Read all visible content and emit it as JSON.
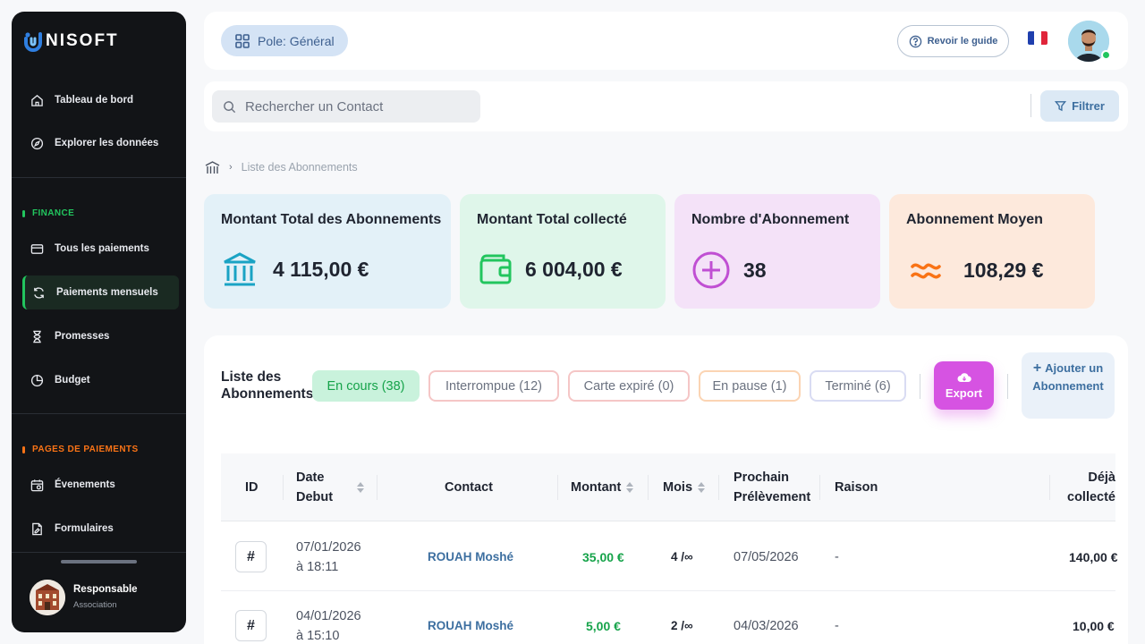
{
  "app": {
    "logo_text": "NISOFT"
  },
  "sidebar": {
    "top_items": [
      {
        "label": "Tableau de bord",
        "icon": "home-icon"
      },
      {
        "label": "Explorer les données",
        "icon": "compass-icon"
      }
    ],
    "finance_label": "FINANCE",
    "finance_items": [
      {
        "label": "Tous les paiements",
        "icon": "card-icon"
      },
      {
        "label": "Paiements mensuels",
        "icon": "refresh-icon",
        "active": true
      },
      {
        "label": "Promesses",
        "icon": "hourglass-icon"
      },
      {
        "label": "Budget",
        "icon": "pie-icon"
      }
    ],
    "pages_label": "PAGES DE PAIEMENTS",
    "pages_items": [
      {
        "label": "Évenements",
        "icon": "calendar-icon"
      },
      {
        "label": "Formulaires",
        "icon": "form-icon"
      }
    ],
    "profile": {
      "name": "Responsable",
      "role": "Association"
    },
    "colors": {
      "finance": "#22c55e",
      "pages": "#f97316"
    }
  },
  "topbar": {
    "pole_label": "Pole: Général",
    "guide_label": "Revoir le guide"
  },
  "search": {
    "placeholder": "Rechercher un Contact",
    "filter_label": "Filtrer"
  },
  "breadcrumb": {
    "current": "Liste des Abonnements"
  },
  "stats": [
    {
      "title": "Montant Total des Abonnements",
      "value": "4 115,00 €",
      "icon": "bank-icon",
      "bg": "#e3f1f8",
      "accent": "#1aa3c4"
    },
    {
      "title": "Montant Total collecté",
      "value": "6 004,00 €",
      "icon": "wallet-icon",
      "bg": "#dff6ea",
      "accent": "#22c55e"
    },
    {
      "title": "Nombre d'Abonnement",
      "value": "38",
      "icon": "plus-circle-icon",
      "bg": "#f4e2f8",
      "accent": "#c04fd3"
    },
    {
      "title": "Abonnement Moyen",
      "value": "108,29 €",
      "icon": "approx-icon",
      "bg": "#fde9dc",
      "accent": "#f97316"
    }
  ],
  "panel": {
    "title": "Liste des Abonnements",
    "filters": [
      {
        "label": "En cours (38)",
        "active": true
      },
      {
        "label": "Interrompue (12)",
        "border": "#f5c6c6"
      },
      {
        "label": "Carte expiré (0)",
        "border": "#f5c6c6"
      },
      {
        "label": "En pause (1)",
        "border": "#fbd4b3"
      },
      {
        "label": "Terminé (6)",
        "border": "#d9dcf3"
      }
    ],
    "export_label": "Export",
    "add_label": "Ajouter un Abonnement"
  },
  "table": {
    "columns": {
      "id": "ID",
      "date": "Date Debut",
      "contact": "Contact",
      "amount": "Montant",
      "months": "Mois",
      "next": "Prochain Prélèvement",
      "reason": "Raison",
      "collected": "Déjà collecté"
    },
    "rows": [
      {
        "id_symbol": "#",
        "date_line1": "07/01/2026",
        "date_line2": "à 18:11",
        "contact": "ROUAH Moshé",
        "amount": "35,00 €",
        "months": "4 /∞",
        "next": "07/05/2026",
        "reason": "-",
        "collected": "140,00 €"
      },
      {
        "id_symbol": "#",
        "date_line1": "04/01/2026",
        "date_line2": "à 15:10",
        "contact": "ROUAH Moshé",
        "amount": "5,00 €",
        "months": "2 /∞",
        "next": "04/03/2026",
        "reason": "-",
        "collected": "10,00 €"
      }
    ]
  }
}
